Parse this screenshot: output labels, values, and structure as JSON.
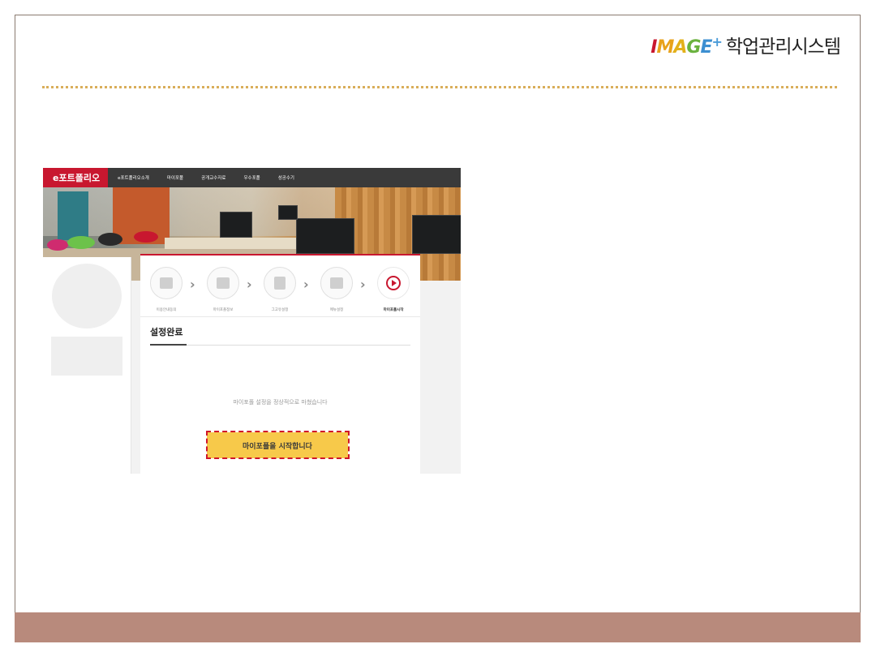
{
  "slide": {
    "logo_letters": [
      {
        "char": "I",
        "color": "#c8172f"
      },
      {
        "char": "M",
        "color": "#e8a21b"
      },
      {
        "char": "A",
        "color": "#e3b11a"
      },
      {
        "char": "G",
        "color": "#6ab23e"
      },
      {
        "char": "E",
        "color": "#3c8fd1"
      }
    ],
    "logo_plus": "+",
    "logo_title": "학업관리시스템",
    "accent_colors": {
      "footer": "#b88a7c",
      "dotted": "#d9ae5a",
      "brand_red": "#c8172f",
      "button_yellow": "#f7c94a"
    }
  },
  "app": {
    "brand": "e포트폴리오",
    "nav": [
      "e포트폴리오소개",
      "마이포폴",
      "공개교수자료",
      "우수포폴",
      "성공수기"
    ],
    "steps": [
      {
        "label": "이용안내동의",
        "icon": "check-icon"
      },
      {
        "label": "마이포폴정보",
        "icon": "keyboard-icon"
      },
      {
        "label": "그고유설정",
        "icon": "book-icon"
      },
      {
        "label": "메뉴설정",
        "icon": "list-icon"
      },
      {
        "label": "마이포폴시작",
        "icon": "play-icon"
      }
    ],
    "section_title": "설정완료",
    "message": "마이포폴 설정을 정상적으로 마쳤습니다",
    "start_button": "마이포폴을 시작합니다"
  }
}
